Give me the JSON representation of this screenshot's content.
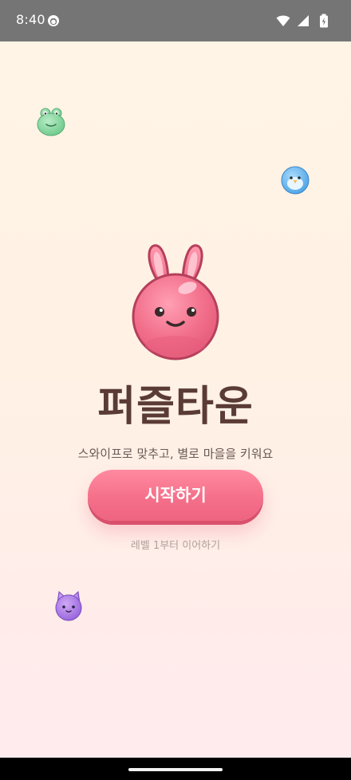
{
  "status_bar": {
    "time": "8:40",
    "icons": [
      "app-notification-icon",
      "wifi-icon",
      "signal-icon",
      "battery-icon"
    ]
  },
  "app": {
    "title": "퍼즐타운",
    "subtitle": "스와이프로 맞추고, 별로 마을을 키워요",
    "start_button_label": "시작하기",
    "continue_label": "레벨 1부터 이어하기"
  },
  "mascots": [
    "bunny-icon",
    "frog-icon",
    "bird-icon",
    "cat-icon"
  ],
  "colors": {
    "accent": "#f5708a",
    "title": "#5a3b35",
    "background_top": "#fff4e6",
    "background_bottom": "#ffe9ee"
  }
}
